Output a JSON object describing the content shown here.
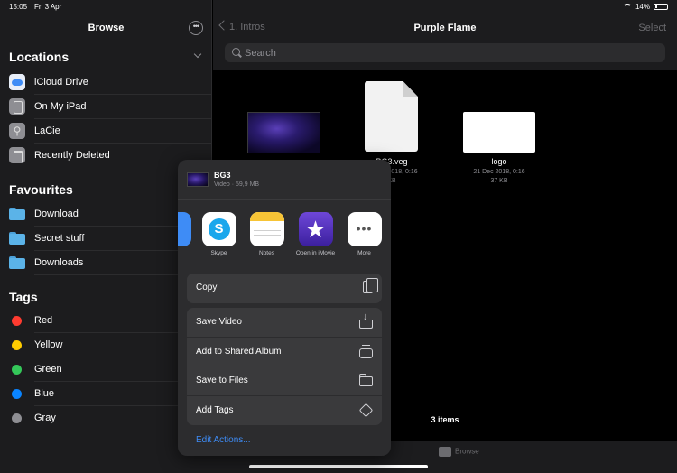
{
  "status": {
    "time": "15:05",
    "date": "Fri 3 Apr",
    "battery": "14%"
  },
  "sidebar": {
    "title": "Browse",
    "locations_heading": "Locations",
    "locations": [
      {
        "label": "iCloud Drive",
        "icon": "icloud-icon"
      },
      {
        "label": "On My iPad",
        "icon": "ipad-icon"
      },
      {
        "label": "LaCie",
        "icon": "usb-icon"
      },
      {
        "label": "Recently Deleted",
        "icon": "trash-icon"
      }
    ],
    "favourites_heading": "Favourites",
    "favourites": [
      {
        "label": "Download",
        "icon": "folder-icon"
      },
      {
        "label": "Secret stuff",
        "icon": "folder-icon"
      },
      {
        "label": "Downloads",
        "icon": "folder-icon"
      }
    ],
    "tags_heading": "Tags",
    "tags": [
      {
        "label": "Red",
        "color": "#ff3b30"
      },
      {
        "label": "Yellow",
        "color": "#ffcc00"
      },
      {
        "label": "Green",
        "color": "#34c759"
      },
      {
        "label": "Blue",
        "color": "#0a84ff"
      },
      {
        "label": "Gray",
        "color": "#8e8e93"
      }
    ]
  },
  "main": {
    "back_label": "1. Intros",
    "title": "Purple Flame",
    "select_label": "Select",
    "search_placeholder": "Search",
    "files": [
      {
        "name": "",
        "date": "",
        "size": ""
      },
      {
        "name": "BG3.veg",
        "date": "21 Dec 2018, 0:16",
        "size": "KB"
      },
      {
        "name": "logo",
        "date": "21 Dec 2018, 0:16",
        "size": "37 KB"
      }
    ],
    "items_count": "3 items"
  },
  "tabbar": {
    "browse_label": "Browse"
  },
  "share_sheet": {
    "file_name": "BG3",
    "file_meta": "Video · 59,9 MB",
    "apps": [
      {
        "label": "",
        "icon": "app-partial-icon"
      },
      {
        "label": "Skype",
        "icon": "skype-icon"
      },
      {
        "label": "Notes",
        "icon": "notes-icon"
      },
      {
        "label": "Open in iMovie",
        "icon": "imovie-icon"
      },
      {
        "label": "More",
        "icon": "more-icon"
      }
    ],
    "copy_label": "Copy",
    "actions": [
      {
        "label": "Save Video",
        "icon": "save-icon"
      },
      {
        "label": "Add to Shared Album",
        "icon": "shared-album-icon"
      },
      {
        "label": "Save to Files",
        "icon": "folder-icon"
      },
      {
        "label": "Add Tags",
        "icon": "tag-icon"
      }
    ],
    "edit_actions_label": "Edit Actions..."
  }
}
